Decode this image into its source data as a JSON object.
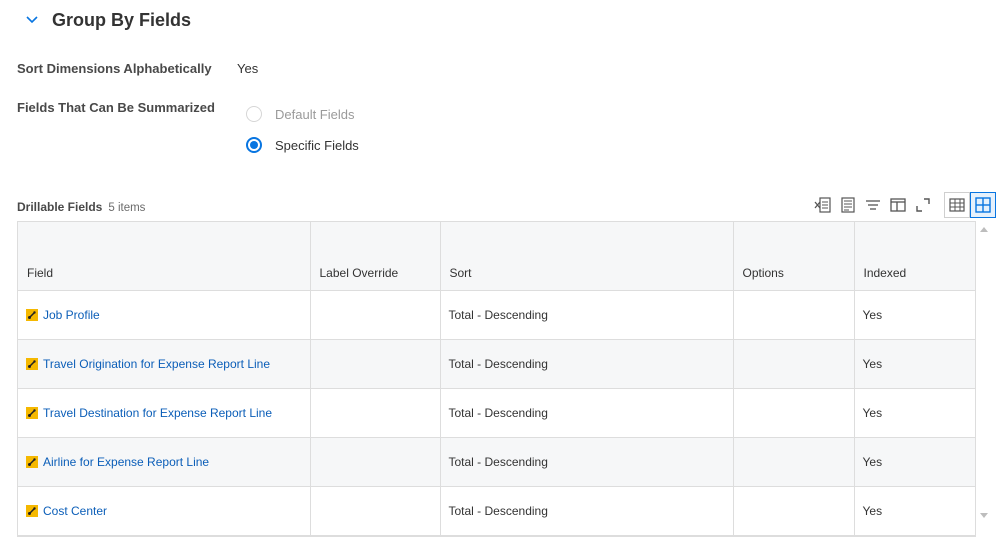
{
  "section": {
    "title": "Group By Fields"
  },
  "sort_dimensions": {
    "label": "Sort Dimensions Alphabetically",
    "value": "Yes"
  },
  "fields_summarized": {
    "label": "Fields That Can Be Summarized",
    "options": [
      {
        "label": "Default Fields",
        "selected": false
      },
      {
        "label": "Specific Fields",
        "selected": true
      }
    ]
  },
  "grid": {
    "title": "Drillable Fields",
    "count": "5 items",
    "columns": [
      "Field",
      "Label Override",
      "Sort",
      "Options",
      "Indexed"
    ],
    "rows": [
      {
        "field": "Job Profile",
        "label_override": "",
        "sort": "Total - Descending",
        "options": "",
        "indexed": "Yes"
      },
      {
        "field": "Travel Origination for Expense Report Line",
        "label_override": "",
        "sort": "Total - Descending",
        "options": "",
        "indexed": "Yes"
      },
      {
        "field": "Travel Destination for Expense Report Line",
        "label_override": "",
        "sort": "Total - Descending",
        "options": "",
        "indexed": "Yes"
      },
      {
        "field": "Airline for Expense Report Line",
        "label_override": "",
        "sort": "Total - Descending",
        "options": "",
        "indexed": "Yes"
      },
      {
        "field": "Cost Center",
        "label_override": "",
        "sort": "Total - Descending",
        "options": "",
        "indexed": "Yes"
      }
    ]
  },
  "toolbar": {
    "icons": [
      "export-excel-icon",
      "export-pdf-icon",
      "filter-icon",
      "column-config-icon",
      "fullscreen-icon"
    ],
    "views": [
      "table-view-icon",
      "grid-view-icon"
    ],
    "active_view": "grid-view-icon"
  },
  "colors": {
    "accent": "#0875e1",
    "link": "#0b5eb8",
    "field_icon": "#f5b800"
  }
}
